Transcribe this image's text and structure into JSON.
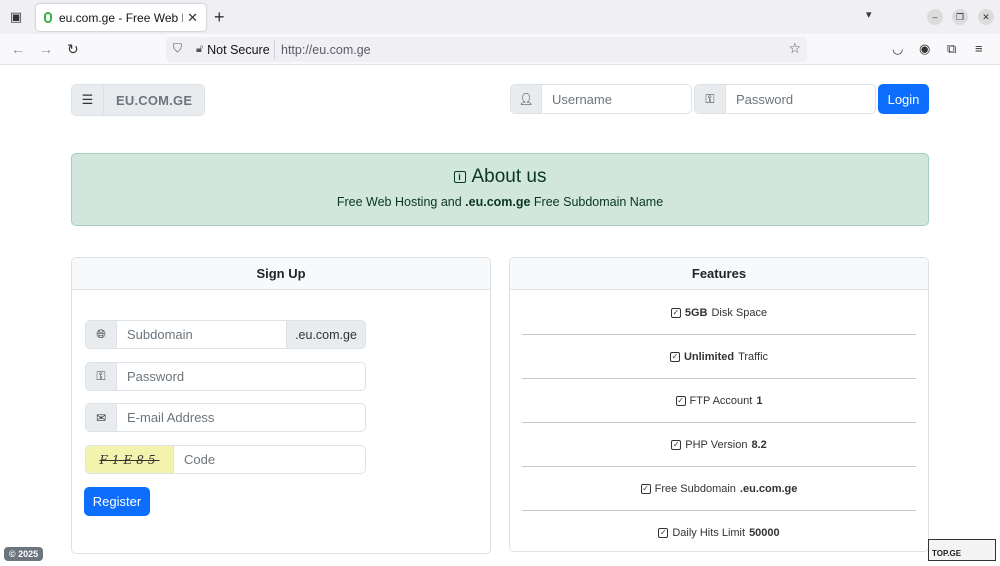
{
  "browser": {
    "tab_title": "eu.com.ge - Free Web Hosting",
    "url_security": "Not Secure",
    "url": "http://eu.com.ge",
    "icons": {
      "tab_list": "tab-list-icon",
      "tab_favicon": "favicon-icon",
      "tab_close": "close-icon",
      "new_tab": "plus-icon",
      "tab_overflow": "chevron-down-icon",
      "minimize": "minimize-icon",
      "restore": "restore-icon",
      "close_window": "close-icon",
      "back": "arrow-left-icon",
      "forward": "arrow-right-icon",
      "reload": "reload-icon",
      "shield": "shield-icon",
      "security": "lock-broken-icon",
      "bookmark": "star-icon",
      "pocket": "pocket-icon",
      "account": "account-icon",
      "extensions": "puzzle-icon",
      "menu": "hamburger-icon"
    }
  },
  "header": {
    "brand_name": "EU.COM.GE",
    "username_placeholder": "Username",
    "password_placeholder": "Password",
    "login_label": "Login"
  },
  "about": {
    "title": "About us",
    "subtitle_prefix": "Free Web Hosting and ",
    "subtitle_domain": ".eu.com.ge",
    "subtitle_suffix": " Free Subdomain Name"
  },
  "signup": {
    "title": "Sign Up",
    "subdomain_placeholder": "Subdomain",
    "subdomain_suffix": ".eu.com.ge",
    "password_placeholder": "Password",
    "email_placeholder": "E-mail Address",
    "captcha_text": "F1E85",
    "code_placeholder": "Code",
    "register_label": "Register"
  },
  "features": {
    "title": "Features",
    "items": [
      {
        "bold_first": true,
        "bold": "5GB",
        "text": " Disk Space"
      },
      {
        "bold_first": true,
        "bold": "Unlimited",
        "text": " Traffic"
      },
      {
        "bold_first": false,
        "text": "FTP Account ",
        "bold": "1"
      },
      {
        "bold_first": false,
        "text": "PHP Version ",
        "bold": "8.2"
      },
      {
        "bold_first": false,
        "text": "Free Subdomain ",
        "bold": ".eu.com.ge"
      },
      {
        "bold_first": false,
        "text": "Daily Hits Limit ",
        "bold": "50000"
      }
    ]
  },
  "footer": {
    "copyright": "© 2025",
    "counter_label": "TOP.GE"
  },
  "colors": {
    "primary": "#0d6efd",
    "alert_bg": "#d1e7dd",
    "alert_text": "#0a3622",
    "captcha_bg": "#f3f3ad"
  }
}
